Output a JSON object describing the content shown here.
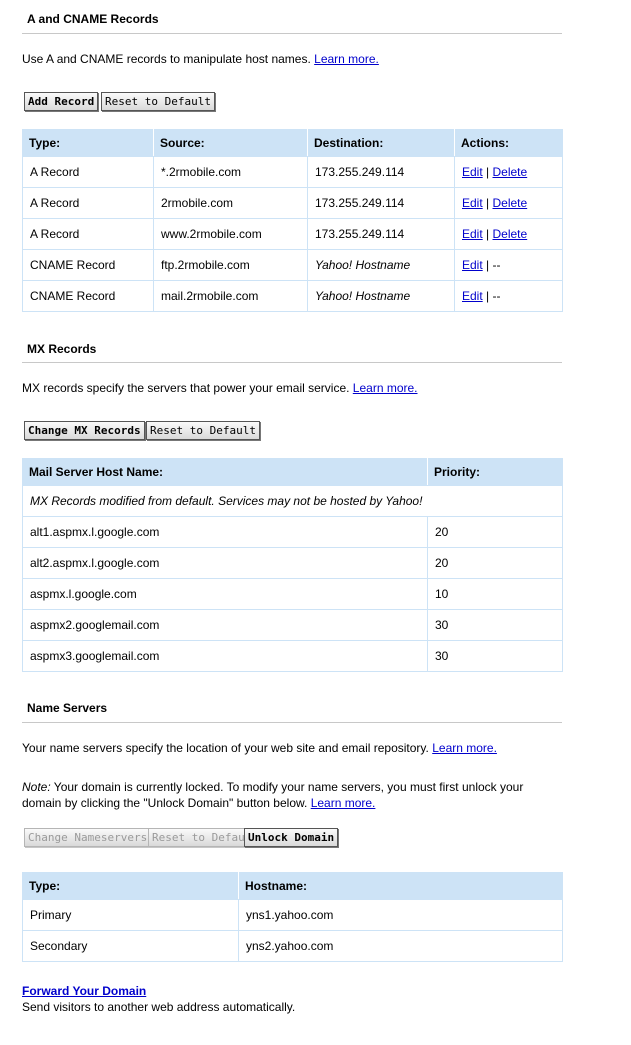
{
  "a_section": {
    "title": "A and CNAME Records",
    "description": "Use A and CNAME records to manipulate host names.",
    "learn_more": "Learn more.",
    "add_button": "Add Record",
    "reset_button": "Reset to Default",
    "headers": [
      "Type:",
      "Source:",
      "Destination:",
      "Actions:"
    ],
    "rows": [
      {
        "type": "A Record",
        "source": "*.2rmobile.com",
        "destination": "173.255.249.114",
        "edit": "Edit",
        "sep": "|",
        "delete": "Delete"
      },
      {
        "type": "A Record",
        "source": "2rmobile.com",
        "destination": "173.255.249.114",
        "edit": "Edit",
        "sep": "|",
        "delete": "Delete"
      },
      {
        "type": "A Record",
        "source": "www.2rmobile.com",
        "destination": "173.255.249.114",
        "edit": "Edit",
        "sep": "|",
        "delete": "Delete"
      },
      {
        "type": "CNAME Record",
        "source": "ftp.2rmobile.com",
        "destination": "Yahoo! Hostname",
        "edit": "Edit",
        "sep": "| --"
      },
      {
        "type": "CNAME Record",
        "source": "mail.2rmobile.com",
        "destination": "Yahoo! Hostname",
        "edit": "Edit",
        "sep": "| --"
      }
    ]
  },
  "mx_section": {
    "title": "MX Records",
    "description": "MX records specify the servers that power your email service.",
    "learn_more": "Learn more.",
    "change_button": "Change MX Records",
    "reset_button": "Reset to Default",
    "headers": [
      "Mail Server Host Name:",
      "Priority:"
    ],
    "note": "MX Records modified from default. Services may not be hosted by Yahoo!",
    "rows": [
      {
        "host": "alt1.aspmx.l.google.com",
        "priority": "20"
      },
      {
        "host": "alt2.aspmx.l.google.com",
        "priority": "20"
      },
      {
        "host": "aspmx.l.google.com",
        "priority": "10"
      },
      {
        "host": "aspmx2.googlemail.com",
        "priority": "30"
      },
      {
        "host": "aspmx3.googlemail.com",
        "priority": "30"
      }
    ]
  },
  "ns_section": {
    "title": "Name Servers",
    "description": "Your name servers specify the location of your web site and email repository.",
    "learn_more": "Learn more.",
    "note_label": "Note:",
    "note_line1": " Your domain is currently locked. To modify your name servers, you must first unlock your",
    "note_line2": "domain by clicking the \"Unlock Domain\" button below.",
    "note_learn_more": "Learn more.",
    "change_button": "Change Nameservers",
    "reset_button": "Reset to Default",
    "unlock_button": "Unlock Domain",
    "headers": [
      "Type:",
      "Hostname:"
    ],
    "rows": [
      {
        "type": "Primary",
        "hostname": "yns1.yahoo.com"
      },
      {
        "type": "Secondary",
        "hostname": "yns2.yahoo.com"
      }
    ]
  },
  "forward": {
    "link": "Forward Your Domain",
    "description": "Send visitors to another web address automatically."
  }
}
